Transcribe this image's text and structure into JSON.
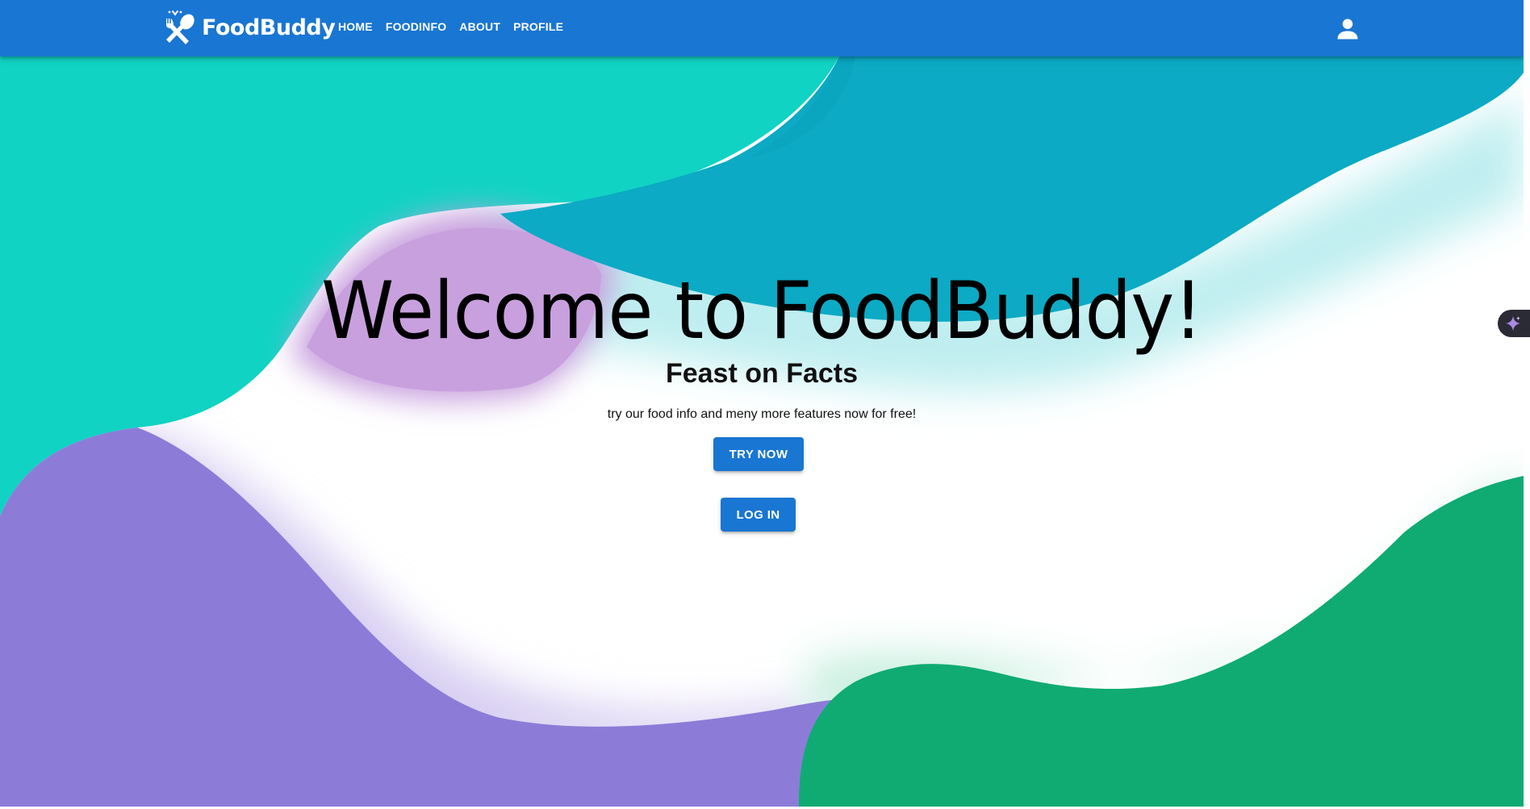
{
  "navbar": {
    "brand": "FoodBuddy",
    "links": [
      "HOME",
      "FOODINFO",
      "ABOUT",
      "PROFILE"
    ],
    "account_icon": "account-icon"
  },
  "hero": {
    "title": "Welcome to FoodBuddy!",
    "subtitle": "Feast on Facts",
    "text": "try our food info and meny more features now for free!",
    "try_button": "TRY NOW",
    "login_button": "LOG IN"
  },
  "colors": {
    "primary": "#1976d2",
    "teal": "#10d3c3",
    "dark_teal": "#0caac4",
    "lavender": "#c8a0de",
    "purple": "#8c7cd8",
    "green": "#0fab73"
  },
  "icons": [
    "fork-knife-logo-icon",
    "account-icon",
    "sparkle-icon"
  ]
}
